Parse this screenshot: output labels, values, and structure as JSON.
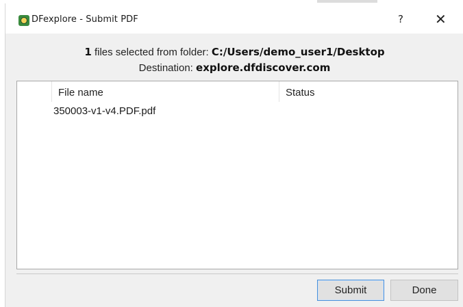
{
  "window": {
    "title": "DFexplore - Submit PDF",
    "help_glyph": "?",
    "close_glyph": "✕",
    "app_icon": "dfexplore-app-icon"
  },
  "info": {
    "count": "1",
    "selected_text": " files selected from folder: ",
    "folder": "C:/Users/demo_user1/Desktop",
    "destination_label": "Destination: ",
    "destination": "explore.dfdiscover.com"
  },
  "table": {
    "columns": [
      "File name",
      "Status"
    ],
    "rows": [
      {
        "file_name": "350003-v1-v4.PDF.pdf",
        "status": ""
      }
    ]
  },
  "buttons": {
    "submit": "Submit",
    "done": "Done"
  },
  "colors": {
    "dialog_bg": "#f0f0f0",
    "focus_border": "#4a8fd8",
    "icon_green": "#3a8a3e"
  }
}
